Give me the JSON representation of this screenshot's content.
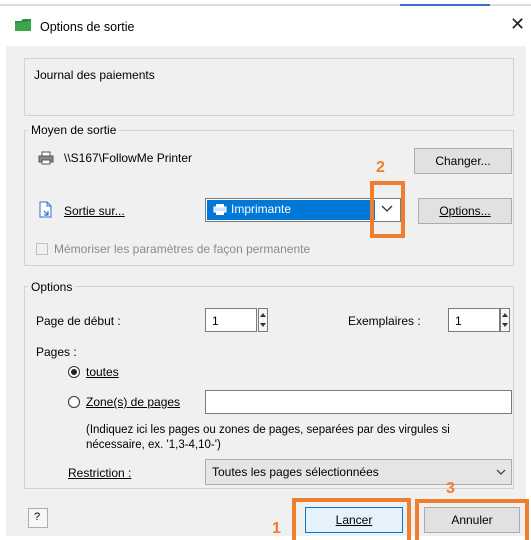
{
  "window": {
    "title": "Options de sortie",
    "close_glyph": "✕"
  },
  "journal": {
    "text": "Journal des paiements"
  },
  "output": {
    "group_label": "Moyen de sortie",
    "printer_name": "\\\\S167\\FollowMe Printer",
    "change_button": "Changer...",
    "output_to_label": "Sortie sur...",
    "output_to_value": "Imprimante",
    "options_button": "Options...",
    "remember_label": "Mémoriser les paramètres de façon permanente",
    "remember_checked": false
  },
  "options": {
    "group_label": "Options",
    "start_page_label": "Page de début :",
    "start_page_value": "1",
    "copies_label": "Exemplaires :",
    "copies_value": "1",
    "pages_label": "Pages :",
    "radio_all_label": "toutes",
    "radio_all_checked": true,
    "radio_range_label": "Zone(s) de pages",
    "radio_range_checked": false,
    "range_value": "",
    "hint": "(Indiquez ici les pages ou zones de pages, separées par des virgules si nécessaire, ex. '1,3-4,10-')",
    "restriction_label": "Restriction :",
    "restriction_value": "Toutes les pages sélectionnées"
  },
  "footer": {
    "help_glyph": "?",
    "launch_button": "Lancer",
    "cancel_button": "Annuler"
  },
  "annotations": {
    "n1": "1",
    "n2": "2",
    "n3": "3",
    "color": "#ef7f2e"
  },
  "icons": {
    "app": "green-folder-icon",
    "printer": "printer-icon",
    "output": "document-arrow-icon",
    "dropdown": "chevron-down-icon",
    "help": "help-icon"
  }
}
